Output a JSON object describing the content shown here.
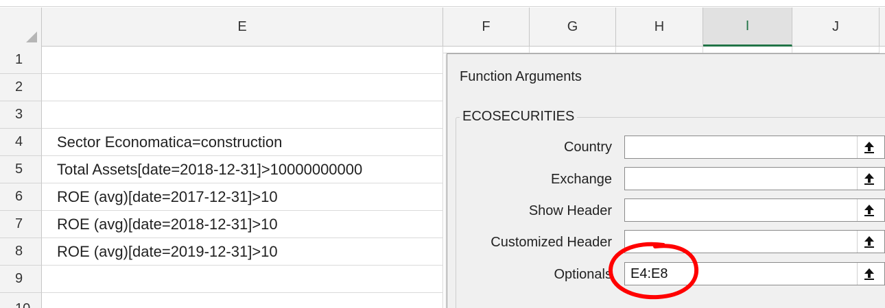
{
  "columns": {
    "E": "E",
    "F": "F",
    "G": "G",
    "H": "H",
    "I": "I",
    "J": "J"
  },
  "rows": [
    "1",
    "2",
    "3",
    "4",
    "5",
    "6",
    "7",
    "8",
    "9",
    "10"
  ],
  "cells": {
    "E4": "Sector Economatica=construction",
    "E5": "Total Assets[date=2018-12-31]>10000000000",
    "E6": "ROE (avg)[date=2017-12-31]>10",
    "E7": "ROE (avg)[date=2018-12-31]>10",
    "E8": "ROE (avg)[date=2019-12-31]>10"
  },
  "dialog": {
    "title": "Function Arguments",
    "function_name": "ECOSECURITIES",
    "arguments": [
      {
        "label": "Country",
        "value": ""
      },
      {
        "label": "Exchange",
        "value": ""
      },
      {
        "label": "Show Header",
        "value": ""
      },
      {
        "label": "Customized Header",
        "value": ""
      },
      {
        "label": "Optionals",
        "value": "E4:E8"
      }
    ]
  },
  "icons": {
    "reference_button": "collapse-dialog-arrow-icon"
  },
  "colors": {
    "selected_column_accent": "#217346",
    "annotation": "#ff0000"
  }
}
